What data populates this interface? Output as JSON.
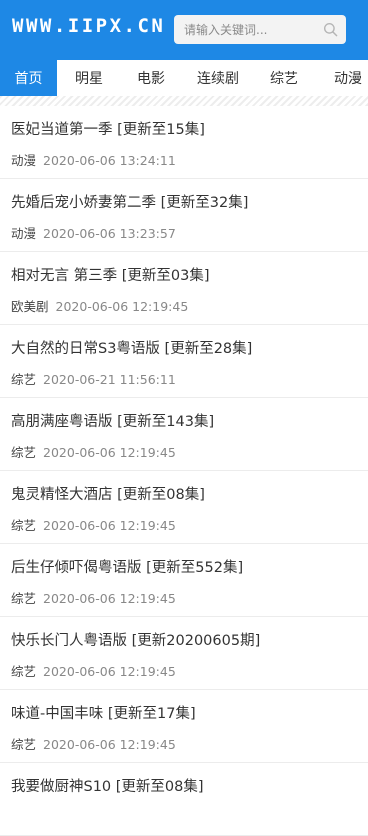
{
  "header": {
    "logo": "WWW.IIPX.CN",
    "search_placeholder": "请输入关键词...",
    "search_icon": "search-icon",
    "background_color": "#1e88e5"
  },
  "nav": {
    "tabs": [
      {
        "label": "首页",
        "active": true
      },
      {
        "label": "明星",
        "active": false
      },
      {
        "label": "电影",
        "active": false
      },
      {
        "label": "连续剧",
        "active": false
      },
      {
        "label": "综艺",
        "active": false
      },
      {
        "label": "动漫",
        "active": false
      }
    ],
    "active_color": "#1e88e5"
  },
  "list": {
    "items": [
      {
        "title": "医妃当道第一季 [更新至15集]",
        "category": "动漫",
        "time": "2020-06-06 13:24:11"
      },
      {
        "title": "先婚后宠小娇妻第二季 [更新至32集]",
        "category": "动漫",
        "time": "2020-06-06 13:23:57"
      },
      {
        "title": "相对无言 第三季 [更新至03集]",
        "category": "欧美剧",
        "time": "2020-06-06 12:19:45"
      },
      {
        "title": "大自然的日常S3粤语版 [更新至28集]",
        "category": "综艺",
        "time": "2020-06-21 11:56:11"
      },
      {
        "title": "高朋满座粤语版 [更新至143集]",
        "category": "综艺",
        "time": "2020-06-06 12:19:45"
      },
      {
        "title": "鬼灵精怪大酒店 [更新至08集]",
        "category": "综艺",
        "time": "2020-06-06 12:19:45"
      },
      {
        "title": "后生仔倾吓偈粤语版 [更新至552集]",
        "category": "综艺",
        "time": "2020-06-06 12:19:45"
      },
      {
        "title": "快乐长门人粤语版 [更新20200605期]",
        "category": "综艺",
        "time": "2020-06-06 12:19:45"
      },
      {
        "title": "味道-中国丰味 [更新至17集]",
        "category": "综艺",
        "time": "2020-06-06 12:19:45"
      },
      {
        "title": "我要做厨神S10 [更新至08集]",
        "category": "",
        "time": ""
      }
    ]
  }
}
